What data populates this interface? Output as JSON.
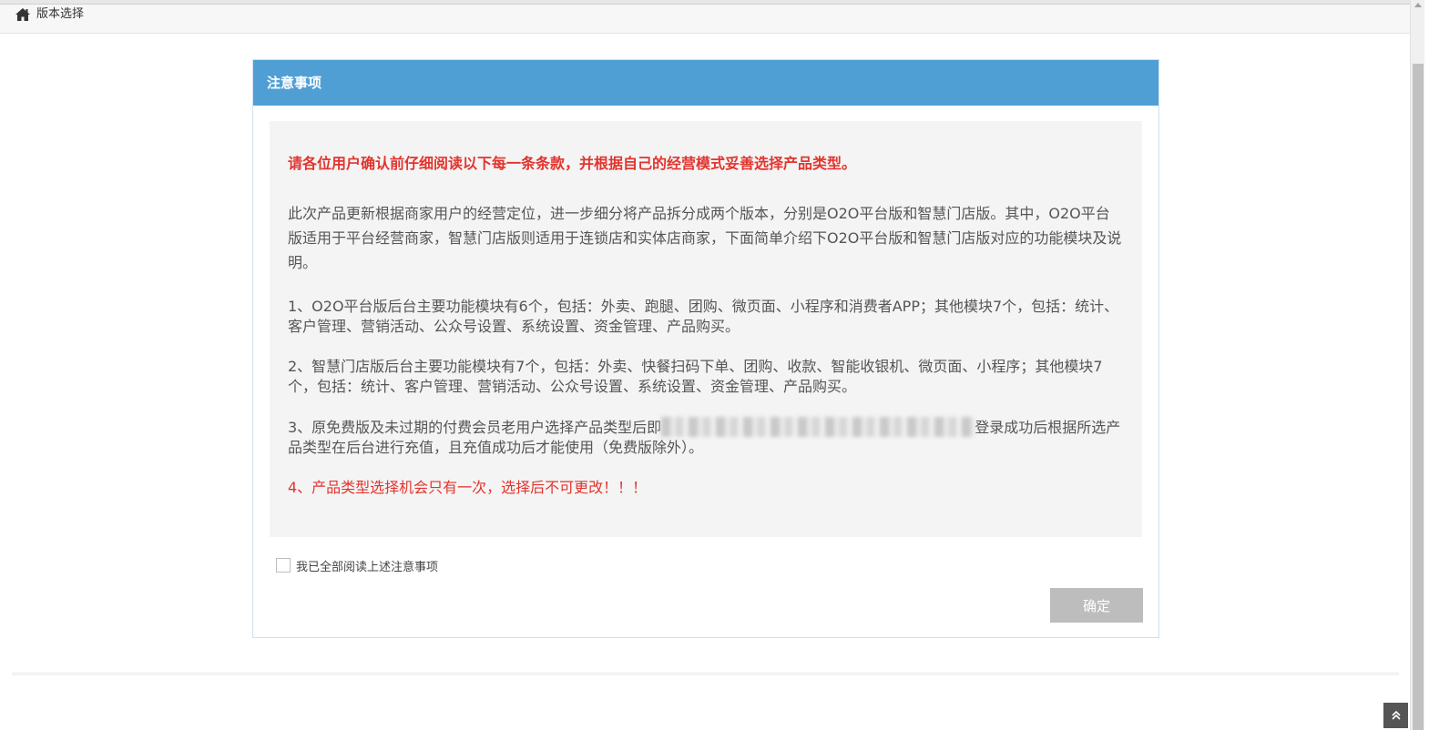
{
  "breadcrumb": {
    "label": "版本选择",
    "icon": "home-icon"
  },
  "panel": {
    "title": "注意事项",
    "notice_heading": "请各位用户确认前仔细阅读以下每一条条款，并根据自己的经营模式妥善选择产品类型。",
    "intro": "此次产品更新根据商家用户的经营定位，进一步细分将产品拆分成两个版本，分别是O2O平台版和智慧门店版。其中，O2O平台版适用于平台经营商家，智慧门店版则适用于连锁店和实体店商家，下面简单介绍下O2O平台版和智慧门店版对应的功能模块及说明。",
    "item1": "1、O2O平台版后台主要功能模块有6个，包括：外卖、跑腿、团购、微页面、小程序和消费者APP；其他模块7个，包括：统计、客户管理、营销活动、公众号设置、系统设置、资金管理、产品购买。",
    "item2": "2、智慧门店版后台主要功能模块有7个，包括：外卖、快餐扫码下单、团购、收款、智能收银机、微页面、小程序；其他模块7个，包括：统计、客户管理、营销活动、公众号设置、系统设置、资金管理、产品购买。",
    "item3_before": "3、原免费版及未过期的付费会员老用户选择产品类型后即",
    "item3_after": "登录成功后根据所选产品类型在后台进行充值，且充值成功后才能使用（免费版除外）。",
    "item4": "4、产品类型选择机会只有一次，选择后不可更改！！！",
    "agree_label": "我已全部阅读上述注意事项",
    "confirm_label": "确定"
  },
  "colors": {
    "header_blue": "#4f9fd5",
    "warning_red": "#e2342e",
    "button_disabled": "#bdbdbd"
  }
}
